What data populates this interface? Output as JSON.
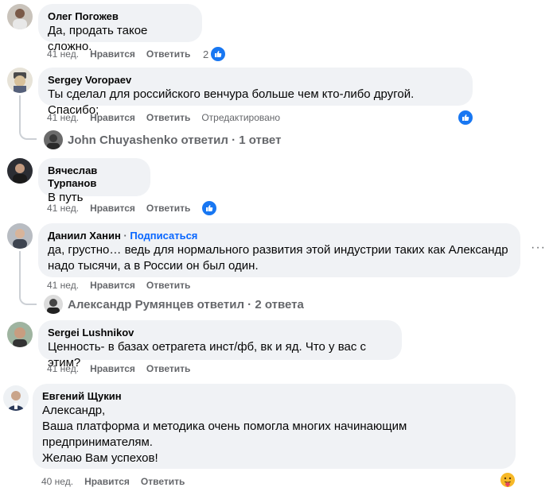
{
  "comments": [
    {
      "author": "Олег Погожев",
      "text": [
        "Да, продать такое сложно."
      ],
      "time": "41 нед.",
      "like": "Нравится",
      "reply": "Ответить",
      "reactions_count": "2"
    },
    {
      "author": "Sergey Voropaev",
      "text": [
        "Ты сделал для российского венчура больше чем кто-либо другой. Спасибо;"
      ],
      "time": "41 нед.",
      "like": "Нравится",
      "reply": "Ответить",
      "edited": "Отредактировано",
      "replies_summary": "John Chuyashenko ответил · 1 ответ"
    },
    {
      "author": "Вячеслав Турпанов",
      "text": [
        "В путь"
      ],
      "time": "41 нед.",
      "like": "Нравится",
      "reply": "Ответить"
    },
    {
      "author": "Даниил Ханин",
      "follow": "Подписаться",
      "text": [
        "да, грустно… ведь для нормального развития этой индустрии таких как Александр",
        "надо тысячи, а в России он был один."
      ],
      "time": "41 нед.",
      "like": "Нравится",
      "reply": "Ответить",
      "replies_summary": "Александр Румянцев ответил · 2 ответа",
      "more": "···"
    },
    {
      "author": "Sergei Lushnikov",
      "text": [
        "Ценность- в базах оетрагета инст/фб, вк и яд. Что у вас с этим?"
      ],
      "time": "41 нед.",
      "like": "Нравится",
      "reply": "Ответить"
    },
    {
      "author": "Евгений Щукин",
      "text": [
        "Александр,",
        "Ваша платформа и методика очень помогла многих начинающим",
        "предпринимателям.",
        "Желаю Вам успехов!"
      ],
      "time": "40 нед.",
      "like": "Нравится",
      "reply": "Ответить"
    }
  ],
  "colors": {
    "bubble": "#f0f2f5",
    "like_blue": "#1877f2",
    "follow_blue": "#0866ff",
    "meta": "#65676b"
  }
}
